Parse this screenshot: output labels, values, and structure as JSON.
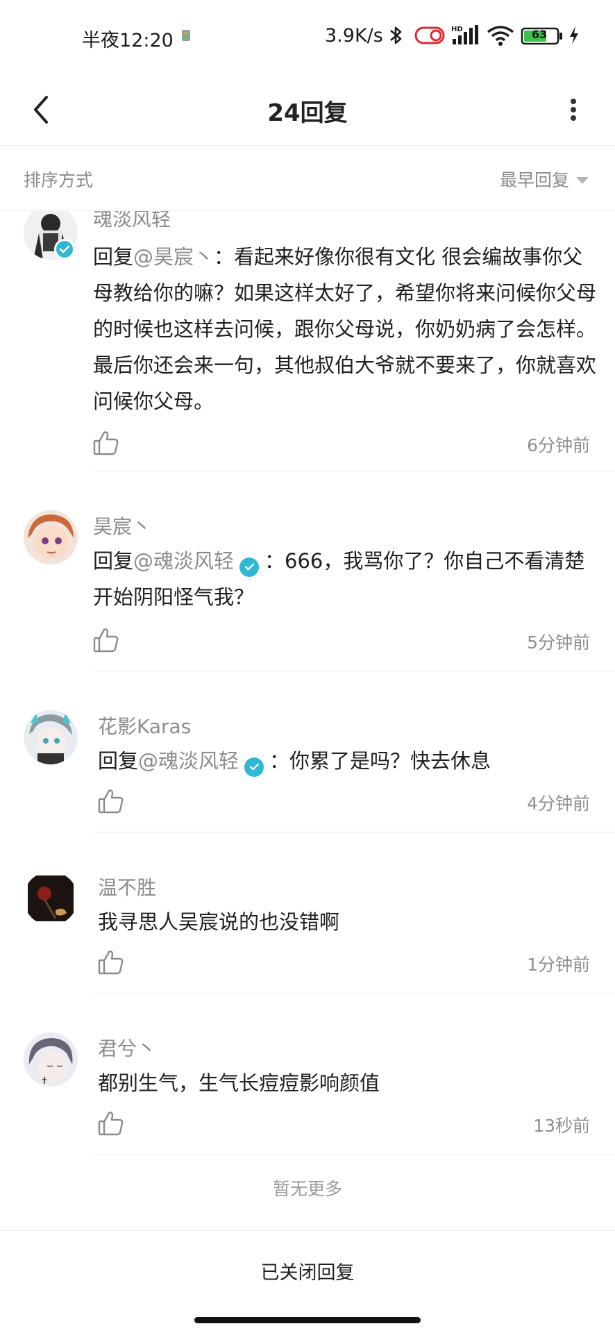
{
  "status_bar": {
    "time": "半夜12:20",
    "net_speed": "3.9K/s",
    "battery": "63"
  },
  "header": {
    "title": "24回复"
  },
  "sort_bar": {
    "label": "排序方式",
    "selected": "最早回复"
  },
  "comments": [
    {
      "name": "魂淡风轻",
      "reply_word": "回复",
      "mention": "@昊宸丶",
      "mention_verified": false,
      "text": "：看起来好像你很有文化 很会编故事你父母教给你的嘛？如果这样太好了，希望你将来问候你父母的时候也这样去问候，跟你父母说，你奶奶病了会怎样。最后你还会来一句，其他叔伯大爷就不要来了，你就喜欢问候你父母。",
      "time": "6分钟前"
    },
    {
      "name": "昊宸丶",
      "reply_word": "回复",
      "mention": "@魂淡风轻",
      "mention_verified": true,
      "text": "：666，我骂你了？你自己不看清楚开始阴阳怪气我？",
      "time": "5分钟前"
    },
    {
      "name": "花影Karas",
      "reply_word": "回复",
      "mention": "@魂淡风轻",
      "mention_verified": true,
      "text": "：你累了是吗？快去休息",
      "time": "4分钟前"
    },
    {
      "name": "温不胜",
      "text": "我寻思人吴宸说的也没错啊",
      "time": "1分钟前"
    },
    {
      "name": "君兮丶",
      "text": "都别生气，生气长痘痘影响颜值",
      "time": "13秒前"
    }
  ],
  "footer": {
    "no_more": "暂无更多",
    "closed": "已关闭回复"
  },
  "colors": {
    "accent_verified": "#2fb8d2",
    "muted_text": "#8c8c8c"
  }
}
